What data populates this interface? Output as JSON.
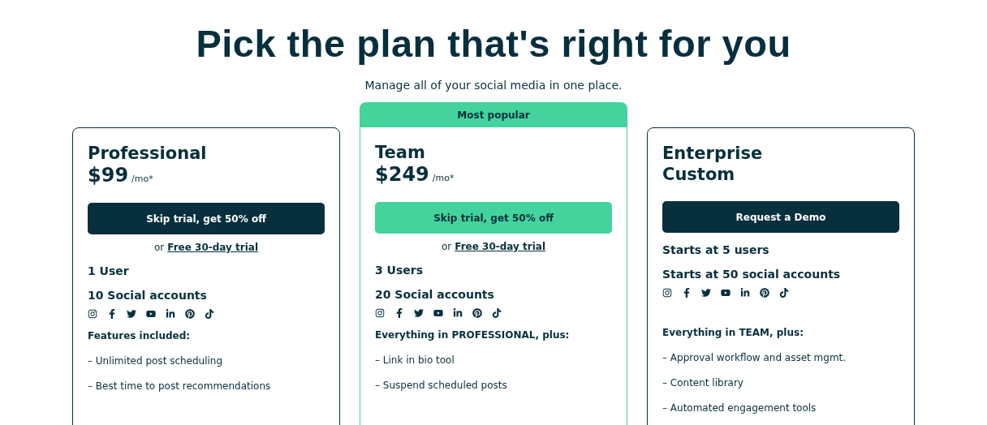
{
  "heading": "Pick the plan that's right for you",
  "subheading": "Manage all of your social media in one place.",
  "plans": [
    {
      "name": "Professional",
      "popular": false,
      "price": "$99",
      "period": "/mo*",
      "button": {
        "label": "Skip trial, get 50% off",
        "kind": "dark"
      },
      "trial": {
        "prefix": "or",
        "link": "Free 30-day trial"
      },
      "stats": [
        "1 User",
        "10 Social accounts"
      ],
      "features_title": "Features included:",
      "features": [
        "– Unlimited post scheduling",
        "– Best time to post recommendations"
      ]
    },
    {
      "name": "Team",
      "popular": true,
      "badge": "Most popular",
      "price": "$249",
      "period": "/mo*",
      "button": {
        "label": "Skip trial, get 50% off",
        "kind": "green"
      },
      "trial": {
        "prefix": "or",
        "link": "Free 30-day trial"
      },
      "stats": [
        "3 Users",
        "20 Social accounts"
      ],
      "features_title": "Everything in PROFESSIONAL, plus:",
      "features": [
        "– Link in bio tool",
        "– Suspend scheduled posts"
      ]
    },
    {
      "name": "Enterprise",
      "popular": false,
      "subtitle": "Custom",
      "button": {
        "label": "Request a Demo",
        "kind": "dark"
      },
      "stats": [
        "Starts at 5 users",
        "Starts at 50 social accounts"
      ],
      "features_title": "Everything in TEAM, plus:",
      "features": [
        "– Approval workflow and asset mgmt.",
        "– Content library",
        "– Automated engagement tools"
      ]
    }
  ]
}
